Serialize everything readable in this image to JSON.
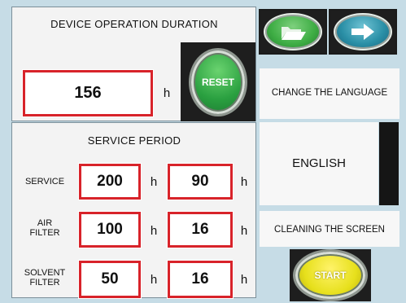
{
  "operation": {
    "title": "DEVICE OPERATION DURATION",
    "hours_value": "156",
    "unit": "h",
    "reset_label": "RESET"
  },
  "service_period": {
    "title": "SERVICE PERIOD",
    "rows": [
      {
        "label": "SERVICE",
        "value1": "200",
        "unit1": "h",
        "value2": "90",
        "unit2": "h"
      },
      {
        "label": "AIR\nFILTER",
        "value1": "100",
        "unit1": "h",
        "value2": "16",
        "unit2": "h"
      },
      {
        "label": "SOLVENT\nFILTER",
        "value1": "50",
        "unit1": "h",
        "value2": "16",
        "unit2": "h"
      }
    ]
  },
  "right": {
    "change_language_label": "CHANGE THE LANGUAGE",
    "language_value": "ENGLISH",
    "cleaning_label": "CLEANING THE SCREEN",
    "start_label": "START"
  },
  "colors": {
    "field_border": "#d8232a",
    "folder_button": "#3fae45",
    "next_button": "#2a8fa6",
    "reset_button": "#33b24a",
    "start_button": "#e7e01c"
  },
  "icons": {
    "folder": "folder-open-icon",
    "next": "arrow-right-icon"
  }
}
